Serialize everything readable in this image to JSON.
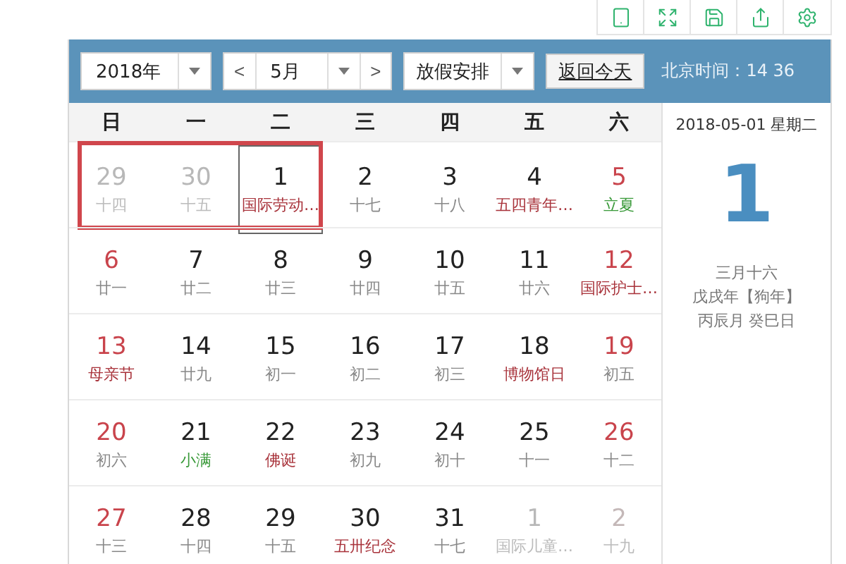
{
  "toolbar": {
    "buttons": [
      {
        "kind": "tablet"
      },
      {
        "kind": "fullscreen"
      },
      {
        "kind": "save"
      },
      {
        "kind": "share"
      },
      {
        "kind": "settings"
      }
    ]
  },
  "header": {
    "year": "2018年",
    "prev": "<",
    "month": "5月",
    "next": ">",
    "holiday": "放假安排",
    "today_button": "返回今天",
    "clock": "北京时间：14 36"
  },
  "weekdays": [
    "日",
    "一",
    "二",
    "三",
    "四",
    "五",
    "六"
  ],
  "weeks": [
    [
      {
        "day": "29",
        "note": "十四",
        "weekend": false,
        "other_month": true,
        "holiday": false,
        "solar_term": false,
        "selected": false,
        "boxed": true
      },
      {
        "day": "30",
        "note": "十五",
        "weekend": false,
        "other_month": true,
        "holiday": false,
        "solar_term": false,
        "selected": false,
        "boxed": true
      },
      {
        "day": "1",
        "note": "国际劳动…",
        "weekend": false,
        "other_month": false,
        "holiday": true,
        "solar_term": false,
        "selected": true,
        "boxed": true
      },
      {
        "day": "2",
        "note": "十七",
        "weekend": false,
        "other_month": false,
        "holiday": false,
        "solar_term": false,
        "selected": false,
        "boxed": false
      },
      {
        "day": "3",
        "note": "十八",
        "weekend": false,
        "other_month": false,
        "holiday": false,
        "solar_term": false,
        "selected": false,
        "boxed": false
      },
      {
        "day": "4",
        "note": "五四青年…",
        "weekend": false,
        "other_month": false,
        "holiday": true,
        "solar_term": false,
        "selected": false,
        "boxed": false
      },
      {
        "day": "5",
        "note": "立夏",
        "weekend": true,
        "other_month": false,
        "holiday": false,
        "solar_term": true,
        "selected": false,
        "boxed": false
      }
    ],
    [
      {
        "day": "6",
        "note": "廿一",
        "weekend": true,
        "other_month": false,
        "holiday": false,
        "solar_term": false,
        "selected": false,
        "boxed": false
      },
      {
        "day": "7",
        "note": "廿二",
        "weekend": false,
        "other_month": false,
        "holiday": false,
        "solar_term": false,
        "selected": false,
        "boxed": false
      },
      {
        "day": "8",
        "note": "廿三",
        "weekend": false,
        "other_month": false,
        "holiday": false,
        "solar_term": false,
        "selected": false,
        "boxed": false
      },
      {
        "day": "9",
        "note": "廿四",
        "weekend": false,
        "other_month": false,
        "holiday": false,
        "solar_term": false,
        "selected": false,
        "boxed": false
      },
      {
        "day": "10",
        "note": "廿五",
        "weekend": false,
        "other_month": false,
        "holiday": false,
        "solar_term": false,
        "selected": false,
        "boxed": false
      },
      {
        "day": "11",
        "note": "廿六",
        "weekend": false,
        "other_month": false,
        "holiday": false,
        "solar_term": false,
        "selected": false,
        "boxed": false
      },
      {
        "day": "12",
        "note": "国际护士…",
        "weekend": true,
        "other_month": false,
        "holiday": true,
        "solar_term": false,
        "selected": false,
        "boxed": false
      }
    ],
    [
      {
        "day": "13",
        "note": "母亲节",
        "weekend": true,
        "other_month": false,
        "holiday": true,
        "solar_term": false,
        "selected": false,
        "boxed": false
      },
      {
        "day": "14",
        "note": "廿九",
        "weekend": false,
        "other_month": false,
        "holiday": false,
        "solar_term": false,
        "selected": false,
        "boxed": false
      },
      {
        "day": "15",
        "note": "初一",
        "weekend": false,
        "other_month": false,
        "holiday": false,
        "solar_term": false,
        "selected": false,
        "boxed": false
      },
      {
        "day": "16",
        "note": "初二",
        "weekend": false,
        "other_month": false,
        "holiday": false,
        "solar_term": false,
        "selected": false,
        "boxed": false
      },
      {
        "day": "17",
        "note": "初三",
        "weekend": false,
        "other_month": false,
        "holiday": false,
        "solar_term": false,
        "selected": false,
        "boxed": false
      },
      {
        "day": "18",
        "note": "博物馆日",
        "weekend": false,
        "other_month": false,
        "holiday": true,
        "solar_term": false,
        "selected": false,
        "boxed": false
      },
      {
        "day": "19",
        "note": "初五",
        "weekend": true,
        "other_month": false,
        "holiday": false,
        "solar_term": false,
        "selected": false,
        "boxed": false
      }
    ],
    [
      {
        "day": "20",
        "note": "初六",
        "weekend": true,
        "other_month": false,
        "holiday": false,
        "solar_term": false,
        "selected": false,
        "boxed": false
      },
      {
        "day": "21",
        "note": "小满",
        "weekend": false,
        "other_month": false,
        "holiday": false,
        "solar_term": true,
        "selected": false,
        "boxed": false
      },
      {
        "day": "22",
        "note": "佛诞",
        "weekend": false,
        "other_month": false,
        "holiday": true,
        "solar_term": false,
        "selected": false,
        "boxed": false
      },
      {
        "day": "23",
        "note": "初九",
        "weekend": false,
        "other_month": false,
        "holiday": false,
        "solar_term": false,
        "selected": false,
        "boxed": false
      },
      {
        "day": "24",
        "note": "初十",
        "weekend": false,
        "other_month": false,
        "holiday": false,
        "solar_term": false,
        "selected": false,
        "boxed": false
      },
      {
        "day": "25",
        "note": "十一",
        "weekend": false,
        "other_month": false,
        "holiday": false,
        "solar_term": false,
        "selected": false,
        "boxed": false
      },
      {
        "day": "26",
        "note": "十二",
        "weekend": true,
        "other_month": false,
        "holiday": false,
        "solar_term": false,
        "selected": false,
        "boxed": false
      }
    ],
    [
      {
        "day": "27",
        "note": "十三",
        "weekend": true,
        "other_month": false,
        "holiday": false,
        "solar_term": false,
        "selected": false,
        "boxed": false
      },
      {
        "day": "28",
        "note": "十四",
        "weekend": false,
        "other_month": false,
        "holiday": false,
        "solar_term": false,
        "selected": false,
        "boxed": false
      },
      {
        "day": "29",
        "note": "十五",
        "weekend": false,
        "other_month": false,
        "holiday": false,
        "solar_term": false,
        "selected": false,
        "boxed": false
      },
      {
        "day": "30",
        "note": "五卅纪念",
        "weekend": false,
        "other_month": false,
        "holiday": true,
        "solar_term": false,
        "selected": false,
        "boxed": false
      },
      {
        "day": "31",
        "note": "十七",
        "weekend": false,
        "other_month": false,
        "holiday": false,
        "solar_term": false,
        "selected": false,
        "boxed": false
      },
      {
        "day": "1",
        "note": "国际儿童…",
        "weekend": false,
        "other_month": true,
        "holiday": false,
        "solar_term": false,
        "selected": false,
        "boxed": false
      },
      {
        "day": "2",
        "note": "十九",
        "weekend": true,
        "other_month": true,
        "holiday": false,
        "solar_term": false,
        "selected": false,
        "boxed": false
      }
    ]
  ],
  "detail": {
    "date": "2018-05-01 星期二",
    "day": "1",
    "lunar": "三月十六",
    "year": "戊戌年【狗年】",
    "month_day": "丙辰月 癸巳日"
  }
}
